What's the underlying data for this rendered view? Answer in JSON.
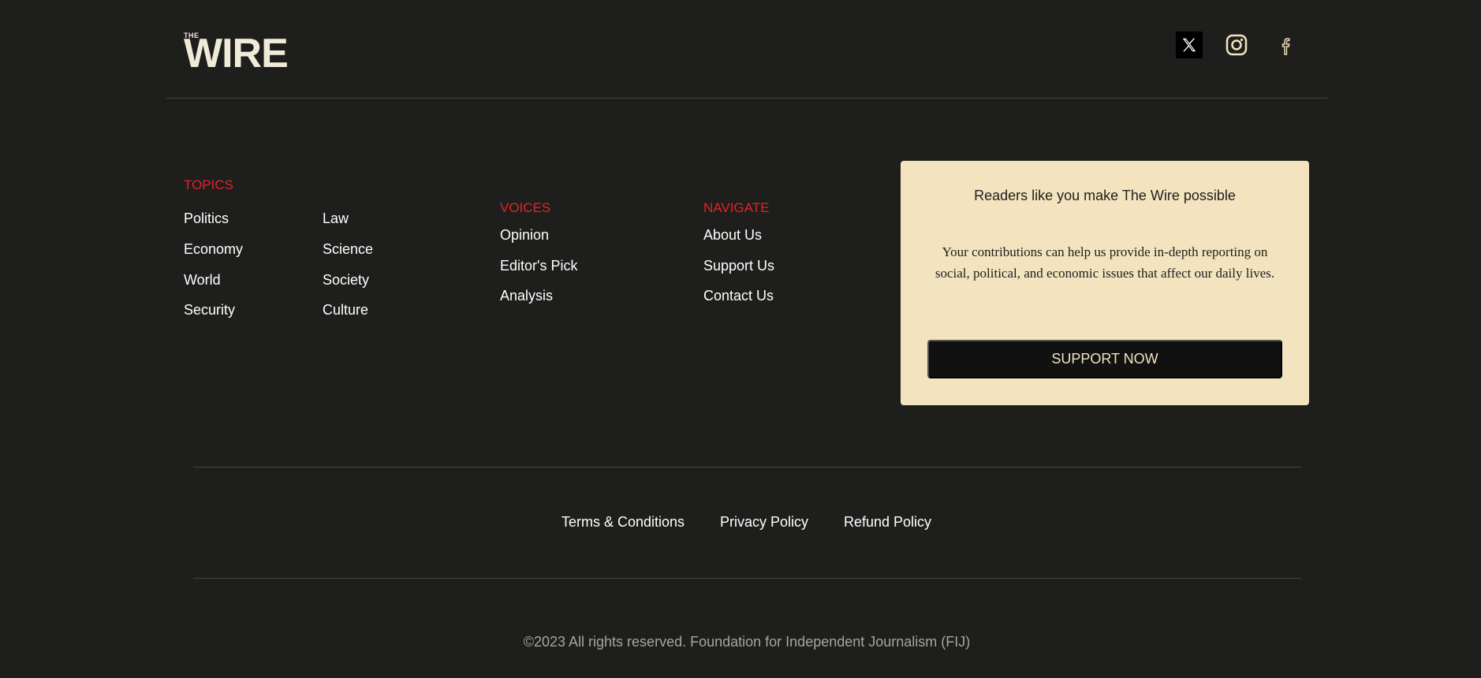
{
  "header": {
    "logo_small": "THE",
    "logo_main": "WIRE",
    "social": [
      {
        "name": "x-icon"
      },
      {
        "name": "instagram-icon"
      },
      {
        "name": "facebook-icon"
      }
    ]
  },
  "topics": {
    "heading": "TOPICS",
    "col1": [
      "Politics",
      "Economy",
      "World",
      "Security"
    ],
    "col2": [
      "Law",
      "Science",
      "Society",
      "Culture"
    ]
  },
  "voices": {
    "heading": "VOICES",
    "items": [
      "Opinion",
      "Editor's Pick",
      "Analysis"
    ]
  },
  "navigate": {
    "heading": "NAVIGATE",
    "items": [
      "About Us",
      "Support Us",
      "Contact Us"
    ]
  },
  "support": {
    "title": "Readers like you make The Wire possible",
    "body": "Your contributions can help us provide in-depth reporting on social, political, and economic issues that affect our daily lives.",
    "button": "SUPPORT NOW"
  },
  "legal": {
    "links": [
      "Terms & Conditions",
      "Privacy Policy",
      "Refund Policy"
    ]
  },
  "copyright": "©2023 All rights reserved. Foundation for Independent Journalism (FIJ)",
  "colors": {
    "background": "#1e1e1c",
    "accent": "#e0242b",
    "card": "#f3e4bf"
  }
}
